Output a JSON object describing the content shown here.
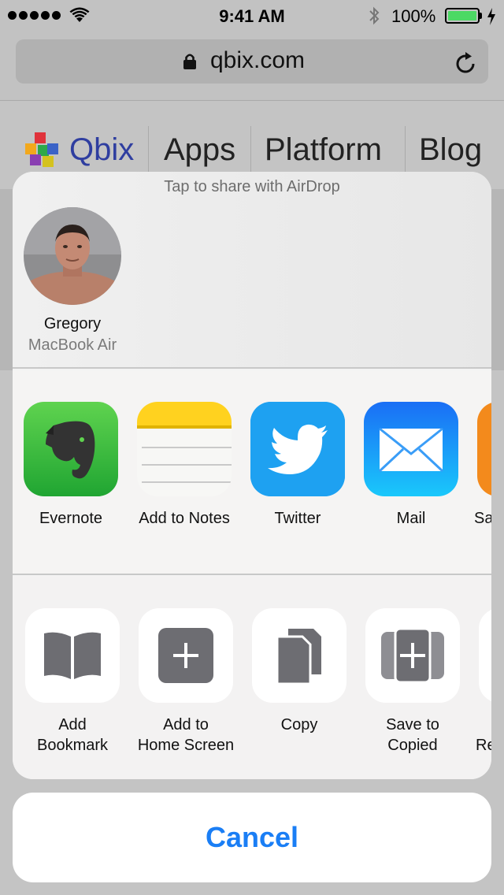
{
  "status_bar": {
    "time": "9:41 AM",
    "battery": "100%"
  },
  "browser": {
    "url": "qbix.com"
  },
  "site_nav": {
    "brand": "Qbix",
    "items": [
      "Apps",
      "Platform",
      "Blog"
    ]
  },
  "airdrop": {
    "hint": "Tap to share with AirDrop",
    "contact_name": "Gregory",
    "contact_device": "MacBook Air"
  },
  "apps": [
    {
      "label": "Evernote",
      "icon": "evernote-icon"
    },
    {
      "label": "Add to Notes",
      "icon": "notes-icon"
    },
    {
      "label": "Twitter",
      "icon": "twitter-icon"
    },
    {
      "label": "Mail",
      "icon": "mail-icon"
    },
    {
      "label": "Sa",
      "icon": "partial-app-icon"
    }
  ],
  "actions": [
    {
      "label_line1": "Add",
      "label_line2": "Bookmark",
      "icon": "book-icon"
    },
    {
      "label_line1": "Add to",
      "label_line2": "Home Screen",
      "icon": "plus-square-icon"
    },
    {
      "label_line1": "Copy",
      "label_line2": "",
      "icon": "copy-icon"
    },
    {
      "label_line1": "Save to",
      "label_line2": "Copied",
      "icon": "save-to-copied-icon"
    },
    {
      "label_line1": "",
      "label_line2": "Re",
      "icon": "partial-action-icon"
    }
  ],
  "cancel_label": "Cancel",
  "colors": {
    "accent": "#1a7ef5",
    "battery": "#4cd964",
    "brand": "#2f3ea0"
  }
}
